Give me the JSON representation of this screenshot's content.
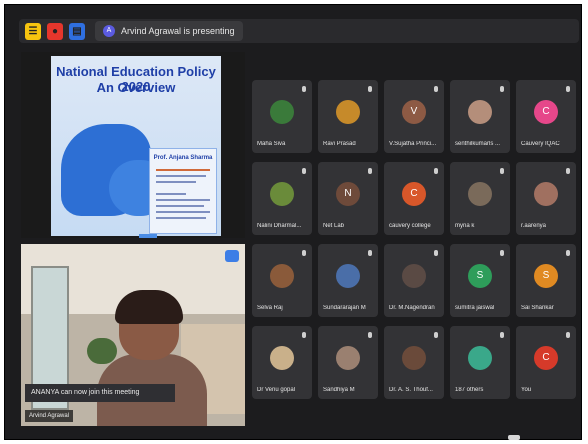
{
  "presenting_text": "Arvind Agrawal is presenting",
  "slide": {
    "title_line1": "National Education Policy 2020",
    "title_line2": "An Overview",
    "presenter_name": "Prof. Anjana Sharma"
  },
  "camera": {
    "toast": "ANANYA can now join this meeting",
    "name": "Arvind Agrawal"
  },
  "participants": [
    {
      "name": "Maha Siva",
      "initial": "",
      "color": "#3a7a3a"
    },
    {
      "name": "Ravi Prasad",
      "initial": "",
      "color": "#c68a2a"
    },
    {
      "name": "V.Sujatha Princi...",
      "initial": "V",
      "color": "#8d5a44"
    },
    {
      "name": "senthilkumarls ...",
      "initial": "",
      "color": "#b48e7a"
    },
    {
      "name": "Cauvery IQAC",
      "initial": "C",
      "color": "#e6478a"
    },
    {
      "name": "Nalini Dharmal...",
      "initial": "",
      "color": "#6a8b3a"
    },
    {
      "name": "Net Lab",
      "initial": "N",
      "color": "#6e4a3a"
    },
    {
      "name": "cauvery college",
      "initial": "C",
      "color": "#d8572a"
    },
    {
      "name": "myna k",
      "initial": "",
      "color": "#7a6a5a"
    },
    {
      "name": "r.aarenya",
      "initial": "",
      "color": "#a07060"
    },
    {
      "name": "Selva Raj",
      "initial": "",
      "color": "#8a5a3a"
    },
    {
      "name": "Sundararajan M",
      "initial": "",
      "color": "#4a6ea8"
    },
    {
      "name": "Dr. M.Nagendran",
      "initial": "",
      "color": "#5a4a44"
    },
    {
      "name": "sumitra jaiswal",
      "initial": "S",
      "color": "#2e9d5a"
    },
    {
      "name": "Sai Shankar",
      "initial": "S",
      "color": "#e08a22"
    },
    {
      "name": "Dr Venu gopal",
      "initial": "",
      "color": "#c9b08a"
    },
    {
      "name": "Sandhiya M",
      "initial": "",
      "color": "#9a8070"
    },
    {
      "name": "Dr. A. S. Thouf...",
      "initial": "",
      "color": "#6a4a3a"
    },
    {
      "name": "187 others",
      "initial": "",
      "color": "#3aa88a"
    },
    {
      "name": "You",
      "initial": "C",
      "color": "#d63a2a"
    }
  ]
}
